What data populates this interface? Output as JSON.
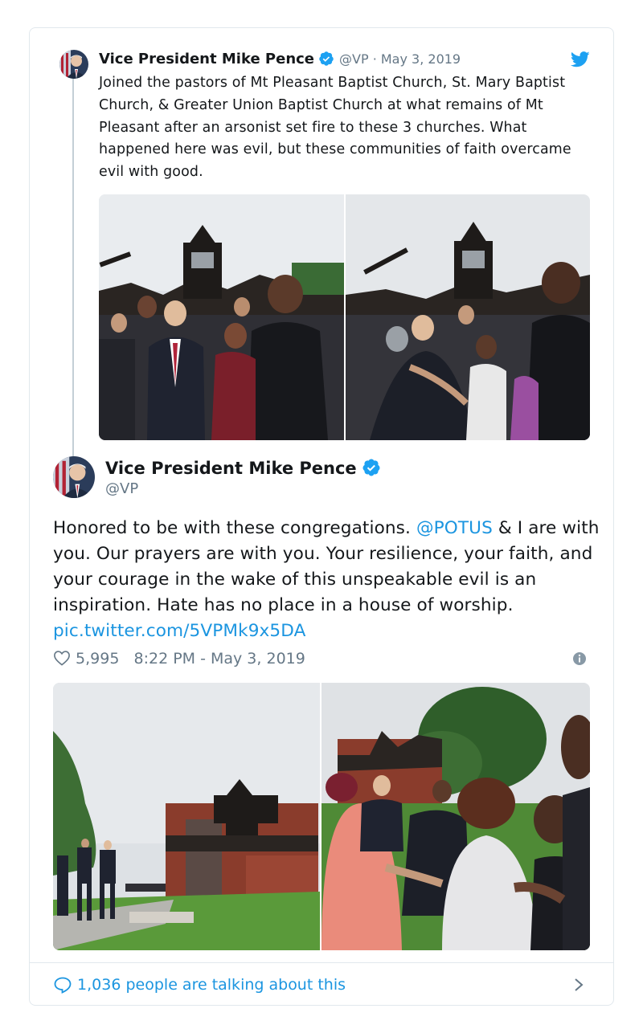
{
  "quoted_tweet": {
    "author_name": "Vice President Mike Pence",
    "handle_date": "@VP · May 3, 2019",
    "text": "Joined the pastors of  Mt Pleasant Baptist Church, St. Mary Baptist Church, & Greater Union Baptist Church at what remains of Mt Pleasant after an arsonist set fire to these 3 churches. What happened here was evil, but these communities of faith overcame evil with good."
  },
  "main_tweet": {
    "author_name": "Vice President Mike Pence",
    "handle": "@VP",
    "text_part1": "Honored to be with these congregations. ",
    "mention": "@POTUS",
    "text_part2": " & I are with you. Our prayers are with you. Your resilience, your faith, and your courage in the wake of this unspeakable evil is an inspiration. Hate has no place in a house of worship. ",
    "pic_link": "pic.twitter.com/5VPMk9x5DA",
    "likes": "5,995",
    "timestamp": "8:22 PM - May 3, 2019"
  },
  "footer": {
    "talking_text": "1,036 people are talking about this"
  },
  "icons": {
    "verified": "verified-badge-icon",
    "bird": "twitter-bird-icon",
    "heart": "heart-icon",
    "info": "info-icon",
    "reply": "speech-bubble-icon",
    "chevron": "chevron-right-icon"
  },
  "colors": {
    "link": "#1b95e0",
    "secondary_text": "#657786",
    "border": "#e1e8ed"
  }
}
